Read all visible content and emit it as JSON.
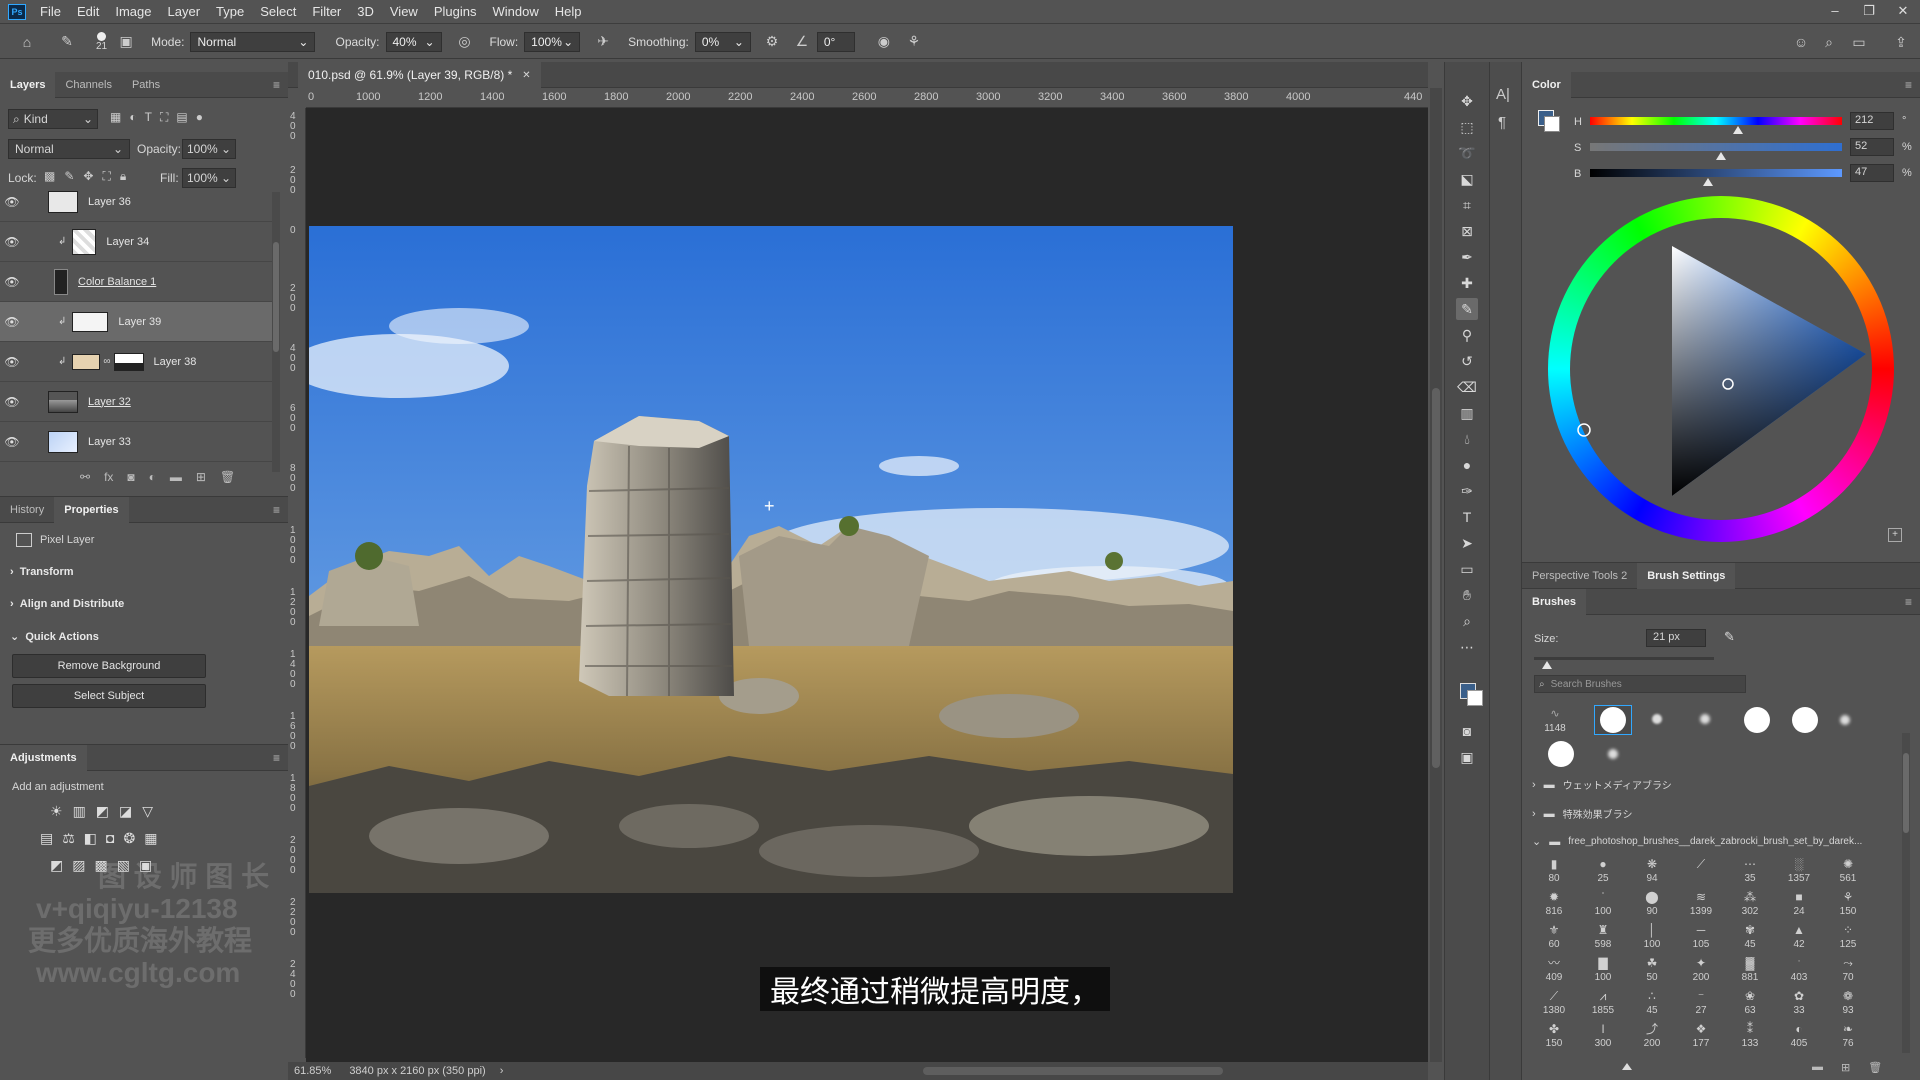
{
  "menubar": {
    "logo": "Ps",
    "items": [
      "File",
      "Edit",
      "Image",
      "Layer",
      "Type",
      "Select",
      "Filter",
      "3D",
      "View",
      "Plugins",
      "Window",
      "Help"
    ]
  },
  "options": {
    "brush_size": "21",
    "mode_label": "Mode:",
    "mode_value": "Normal",
    "opacity_label": "Opacity:",
    "opacity_value": "40%",
    "flow_label": "Flow:",
    "flow_value": "100%",
    "smoothing_label": "Smoothing:",
    "smoothing_value": "0%",
    "angle_value": "0°"
  },
  "layers_panel": {
    "tabs": [
      "Layers",
      "Channels",
      "Paths"
    ],
    "filter_kind": "Kind",
    "blend_mode": "Normal",
    "opacity_label": "Opacity:",
    "opacity_value": "100%",
    "lock_label": "Lock:",
    "fill_label": "Fill:",
    "fill_value": "100%",
    "layers": [
      {
        "name": "Layer 36"
      },
      {
        "name": "Layer 34"
      },
      {
        "name": "Color Balance 1"
      },
      {
        "name": "Layer 39"
      },
      {
        "name": "Layer 38"
      },
      {
        "name": "Layer 32"
      },
      {
        "name": "Layer 33"
      }
    ]
  },
  "properties_panel": {
    "tabs": [
      "History",
      "Properties"
    ],
    "kind": "Pixel Layer",
    "sections": [
      "Transform",
      "Align and Distribute",
      "Quick Actions"
    ],
    "buttons": [
      "Remove Background",
      "Select Subject"
    ]
  },
  "adjustments_panel": {
    "title": "Adjustments",
    "subtitle": "Add an adjustment"
  },
  "watermark": {
    "lines": [
      "图 设 师 图 长",
      "v+qiqiyu-12138",
      "更多优质海外教程",
      "www.cgltg.com"
    ]
  },
  "document": {
    "tab_title": "010.psd @ 61.9% (Layer 39, RGB/8) *",
    "ruler_labels": [
      "0",
      "1000",
      "1200",
      "1400",
      "1600",
      "1800",
      "2000",
      "2200",
      "2400",
      "2600",
      "2800",
      "3000",
      "3200",
      "3400",
      "3600",
      "3800",
      "4000",
      "440"
    ],
    "ruler_v_labels": [
      "400",
      "200",
      "0",
      "200",
      "400",
      "600",
      "800",
      "1000",
      "1200",
      "1400",
      "1600",
      "1800",
      "2000",
      "2200",
      "2400"
    ],
    "subtitle": "最终通过稍微提高明度，",
    "status_zoom": "61.85%",
    "status_info": "3840 px x 2160 px (350 ppi)"
  },
  "color_panel": {
    "title": "Color",
    "h_label": "H",
    "h_value": "212",
    "h_unit": "°",
    "s_label": "S",
    "s_value": "52",
    "s_unit": "%",
    "b_label": "B",
    "b_value": "47",
    "b_unit": "%",
    "h_level": 0.589,
    "s_level": 0.52,
    "b_level": 0.47
  },
  "brush_settings": {
    "tabs": [
      "Perspective Tools 2",
      "Brush Settings"
    ],
    "title": "Brushes",
    "size_label": "Size:",
    "size_value": "21 px",
    "search_placeholder": "Search Brushes",
    "recent_count": "1148",
    "folders": [
      "ウェットメディアブラシ",
      "特殊効果ブラシ",
      "free_photoshop_brushes__darek_zabrocki_brush_set_by_darek..."
    ],
    "brush_sizes": [
      [
        "80",
        "25",
        "94",
        "",
        "35",
        "1357",
        "561"
      ],
      [
        "816",
        "100",
        "90",
        "1399",
        "302",
        "24",
        "150"
      ],
      [
        "60",
        "598",
        "100",
        "105",
        "45",
        "42",
        "125"
      ],
      [
        "409",
        "100",
        "50",
        "200",
        "881",
        "403",
        "70"
      ],
      [
        "1380",
        "1855",
        "45",
        "27",
        "63",
        "33",
        "93"
      ],
      [
        "150",
        "300",
        "200",
        "177",
        "133",
        "405",
        "76"
      ]
    ]
  },
  "colors": {
    "foreground": "#3a5f8a",
    "accent": "#31a8ff"
  }
}
